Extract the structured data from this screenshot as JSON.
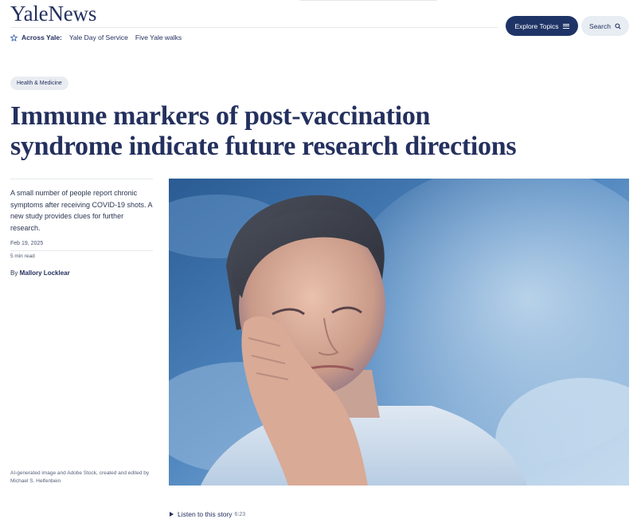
{
  "header": {
    "logo": "YaleNews",
    "explore_label": "Explore Topics",
    "search_label": "Search"
  },
  "across_yale": {
    "label": "Across Yale:",
    "links": [
      "Yale Day of Service",
      "Five Yale walks"
    ]
  },
  "article": {
    "category": "Health & Medicine",
    "headline_line1": "Immune markers of post-vaccination",
    "headline_line2": "syndrome indicate future research directions",
    "summary": "A small number of people report chronic symptoms after receiving COVID-19 shots. A new study provides clues for further research.",
    "date": "Feb 19, 2025",
    "read_time": "5 min read",
    "byline_prefix": "By",
    "author": "Mallory Locklear",
    "image_caption": "AI-generated image and Adobe Stock, created and edited by Michael S. Helfenbein",
    "listen_label": "Listen to this story",
    "listen_duration": "6:23"
  },
  "colors": {
    "brand_navy": "#1f3466",
    "text_navy": "#24305e",
    "pill_bg": "#e9edf2"
  },
  "icons": [
    "star-icon",
    "menu-icon",
    "search-icon",
    "play-icon"
  ]
}
